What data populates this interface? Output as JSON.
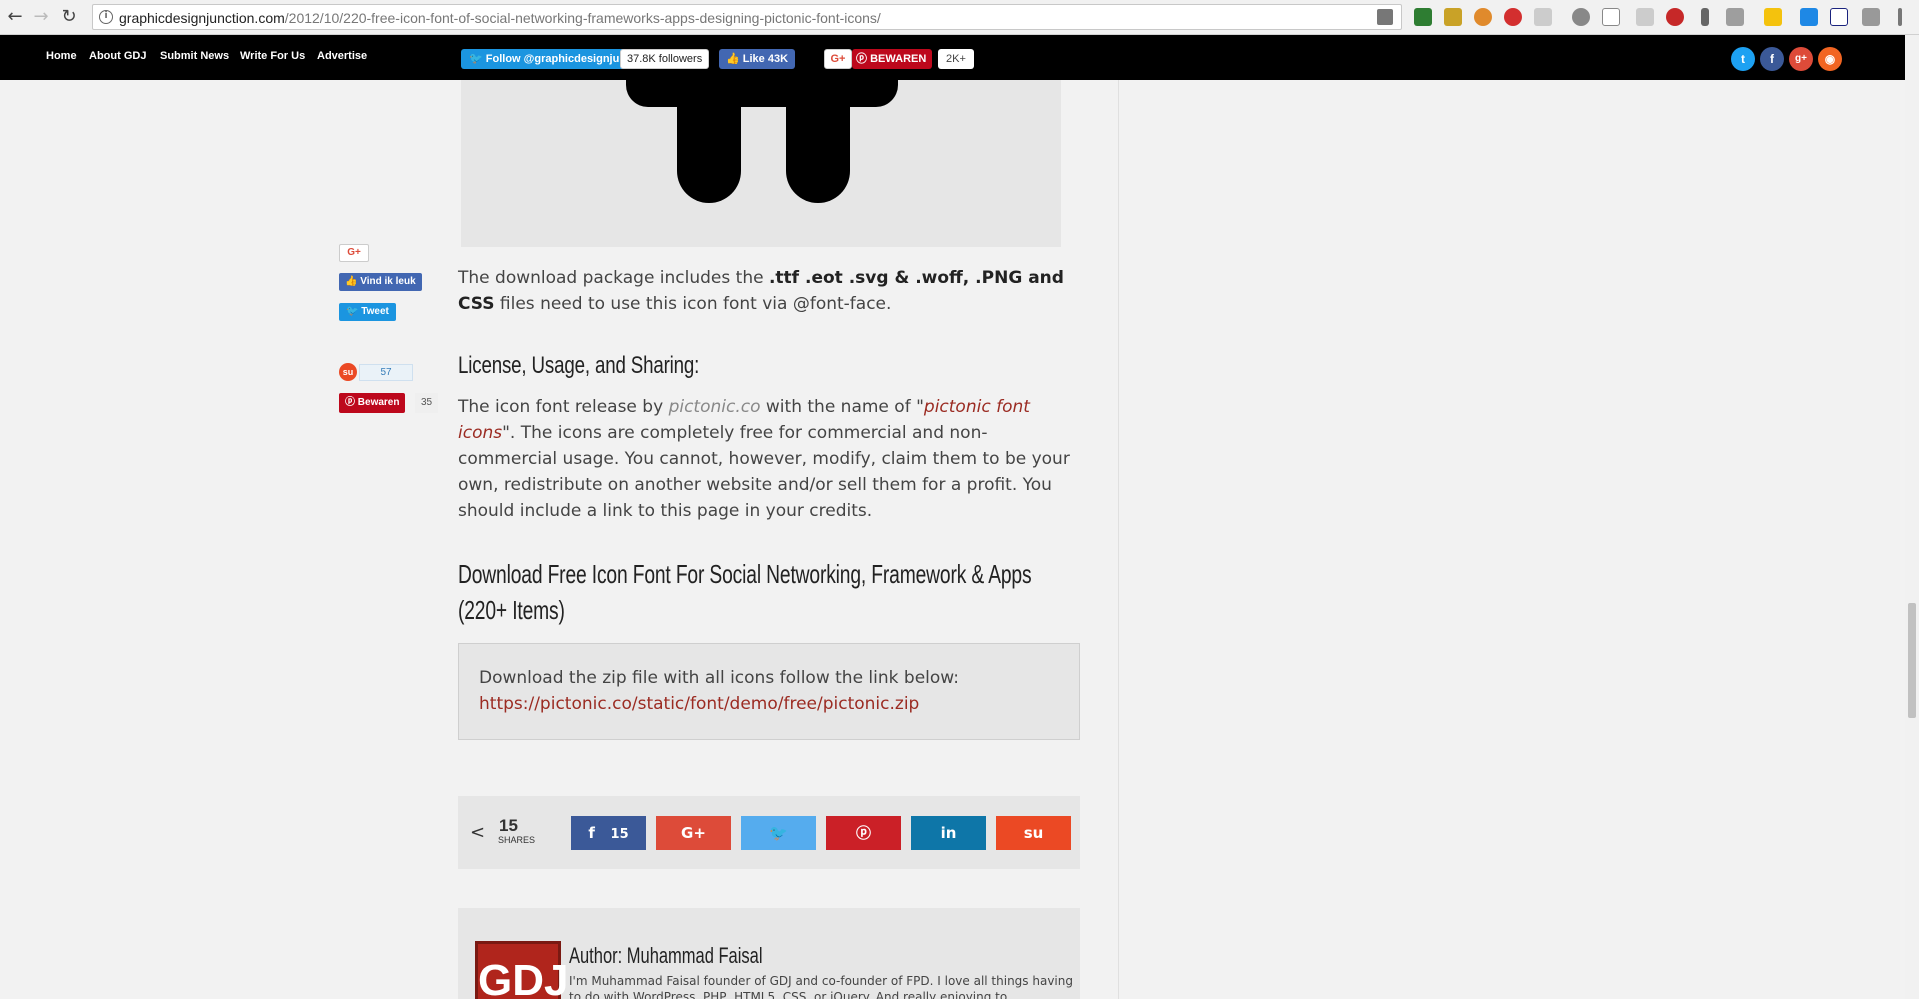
{
  "browser": {
    "url_domain": "graphicdesignjunction.com",
    "url_path": "/2012/10/220-free-icon-font-of-social-networking-frameworks-apps-designing-pictonic-font-icons/"
  },
  "site_nav": {
    "items": [
      "Home",
      "About GDJ",
      "Submit News",
      "Write For Us",
      "Advertise"
    ]
  },
  "social_bar": {
    "twitter_follow": "Follow @graphicdesignju",
    "twitter_count": "37.8K followers",
    "facebook_like": "Like 43K",
    "gplus": "G+",
    "pinterest_save": "BEWAREN",
    "pinterest_count": "2K+"
  },
  "float_share": {
    "gplus": "G+",
    "fb_like": "Vind ik leuk",
    "tweet": "Tweet",
    "stumble_count": "57",
    "pin_save": "Bewaren",
    "pin_count": "35"
  },
  "article": {
    "p1_intro": "The download package includes the ",
    "p1_bold": ".ttf .eot .svg & .woff, .PNG and CSS",
    "p1_rest": " files need to use this icon font via @font-face.",
    "license_heading": "License, Usage, and Sharing:",
    "p2_a": "The icon font release by ",
    "p2_link1": "pictonic.co",
    "p2_b": " with the name of \"",
    "p2_link2": "pictonic font icons",
    "p2_c": "\". The icons are completely free for commercial and non-commercial usage. You cannot, however, modify, claim them to be your own, redistribute on another website and/or sell them for a profit. You should include a link to this page in your credits.",
    "download_heading": "Download Free Icon Font For Social Networking, Framework & Apps (220+ Items)",
    "dl_text": "Download the zip file with all icons follow the link below:",
    "dl_link": "https://pictonic.co/static/font/demo/free/pictonic.zip"
  },
  "share_panel": {
    "total": "15",
    "label": "SHARES",
    "facebook_count": "15"
  },
  "author": {
    "logo_text": "GDJ",
    "name": "Author: Muhammad Faisal",
    "bio": "I'm Muhammad Faisal founder of GDJ and co-founder of FPD. I love all things having to do with WordPress, PHP, HTML5, CSS, or jQuery. And really enjoying to"
  },
  "colors": {
    "facebook": "#3b5998",
    "gplus": "#dd4b39",
    "twitter": "#55acee",
    "pinterest": "#cb2027",
    "linkedin": "#0e76a8",
    "stumbleupon": "#eb4924",
    "link": "#9b2b22"
  }
}
